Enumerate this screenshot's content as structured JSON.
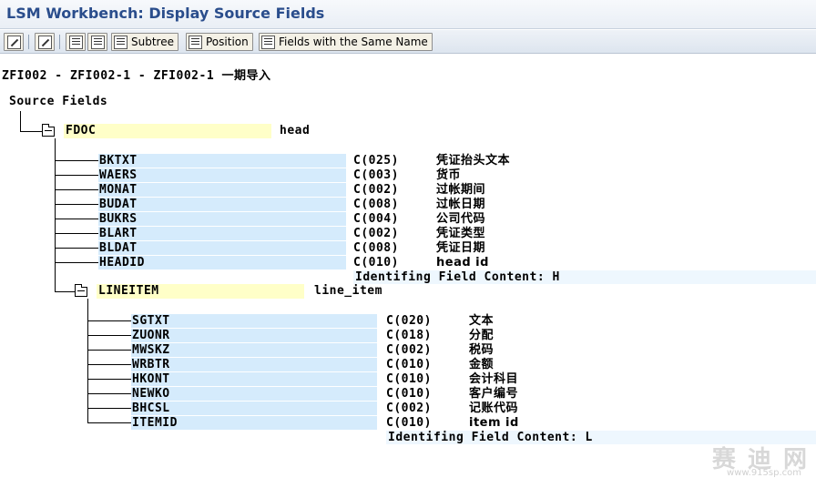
{
  "title": "LSM Workbench: Display Source Fields",
  "toolbar": {
    "subtree_label": "Subtree",
    "position_label": "Position",
    "same_name_label": "Fields with the Same Name"
  },
  "breadcrumb": "ZFI002 - ZFI002-1 - ZFI002-1 一期导入",
  "source_label": "Source Fields",
  "structures": [
    {
      "name": "FDOC",
      "desc": "head",
      "fields": [
        {
          "name": "BKTXT",
          "type": "C(025)",
          "desc": "凭证抬头文本"
        },
        {
          "name": "WAERS",
          "type": "C(003)",
          "desc": "货币"
        },
        {
          "name": "MONAT",
          "type": "C(002)",
          "desc": "过帐期间"
        },
        {
          "name": "BUDAT",
          "type": "C(008)",
          "desc": "过帐日期"
        },
        {
          "name": "BUKRS",
          "type": "C(004)",
          "desc": "公司代码"
        },
        {
          "name": "BLART",
          "type": "C(002)",
          "desc": "凭证类型"
        },
        {
          "name": "BLDAT",
          "type": "C(008)",
          "desc": "凭证日期"
        },
        {
          "name": "HEADID",
          "type": "C(010)",
          "desc": "head id"
        }
      ],
      "ident": "Identifing Field Content: H"
    },
    {
      "name": "LINEITEM",
      "desc": "line_item",
      "fields": [
        {
          "name": "SGTXT",
          "type": "C(020)",
          "desc": "文本"
        },
        {
          "name": "ZUONR",
          "type": "C(018)",
          "desc": "分配"
        },
        {
          "name": "MWSKZ",
          "type": "C(002)",
          "desc": "税码"
        },
        {
          "name": "WRBTR",
          "type": "C(010)",
          "desc": "金额"
        },
        {
          "name": "HKONT",
          "type": "C(010)",
          "desc": "会计科目"
        },
        {
          "name": "NEWKO",
          "type": "C(010)",
          "desc": "客户编号"
        },
        {
          "name": "BHCSL",
          "type": "C(002)",
          "desc": "记账代码"
        },
        {
          "name": "ITEMID",
          "type": "C(010)",
          "desc": "item id"
        }
      ],
      "ident": "Identifing Field Content: L"
    }
  ],
  "watermark": {
    "text": "赛 迪 网",
    "url": "www.915sp.com"
  },
  "colors": {
    "title": "#2a4d8c",
    "field_bg": "#d5ebfc",
    "struct_bg": "#ffffc8",
    "ident_bg": "#eef7fe"
  }
}
